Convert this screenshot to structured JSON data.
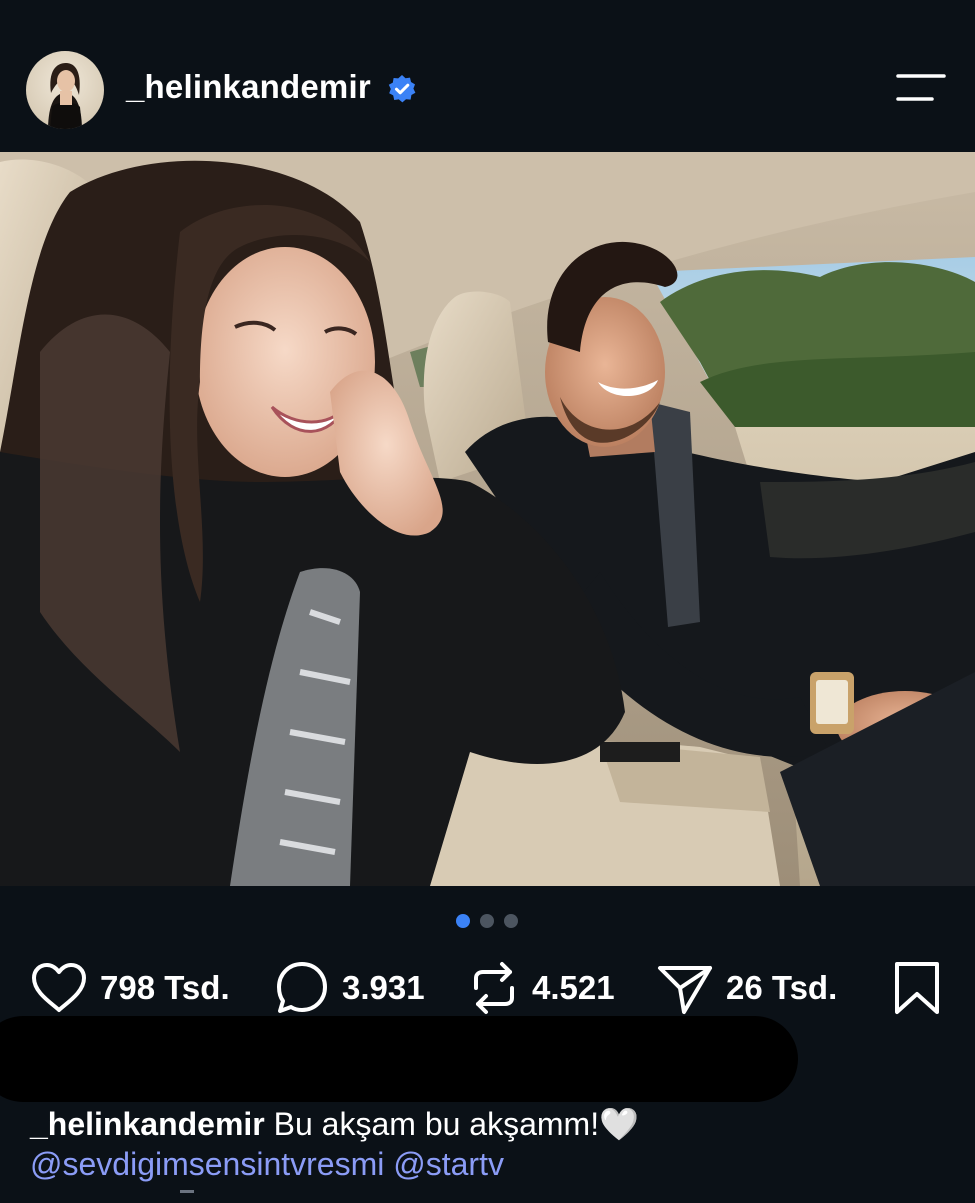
{
  "post": {
    "username": "_helinkandemir",
    "caption_text": "Bu akşam bu akşamm!",
    "caption_emoji": "🤍",
    "mentions": [
      "@sevdigimsensintvresmi",
      "@startv"
    ]
  },
  "actions": {
    "likes": "798 Tsd.",
    "comments": "3.931",
    "reposts": "4.521",
    "shares": "26 Tsd."
  },
  "carousel": {
    "total": 3,
    "active": 1
  },
  "colors": {
    "background": "#0b1117",
    "verified_badge": "#3b82f6",
    "active_dot": "#3b82f6",
    "mention": "#8b9cf6"
  },
  "icons": {
    "verified": "verified-badge-icon",
    "menu": "menu-icon",
    "like": "heart-icon",
    "comment": "comment-icon",
    "repost": "repost-icon",
    "share": "send-icon",
    "save": "bookmark-icon"
  }
}
